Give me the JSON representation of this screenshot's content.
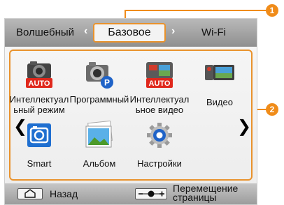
{
  "tabs": {
    "left": "Волшебный",
    "selected": "Базовое",
    "right": "Wi-Fi"
  },
  "modes": [
    {
      "label": "Интеллектуальный режим",
      "icon": "smart-auto-camera-icon"
    },
    {
      "label": "Программный",
      "icon": "program-camera-icon"
    },
    {
      "label": "Интеллектуальное видео",
      "icon": "smart-auto-video-icon"
    },
    {
      "label": "Видео",
      "icon": "video-camera-icon"
    },
    {
      "label": "Smart",
      "icon": "smart-icon"
    },
    {
      "label": "Альбом",
      "icon": "album-icon"
    },
    {
      "label": "Настройки",
      "icon": "settings-gear-icon"
    }
  ],
  "bottom_bar": {
    "back_label": "Назад",
    "page_label_line1": "Перемещение",
    "page_label_line2": "страницы"
  },
  "callouts": {
    "one": "1",
    "two": "2"
  },
  "icon_badges": {
    "auto": "AUTO",
    "program": "P"
  },
  "colors": {
    "accent": "#e9922c",
    "callout": "#f08c1a",
    "auto_badge": "#e0281c",
    "program_badge": "#1f63c8"
  }
}
